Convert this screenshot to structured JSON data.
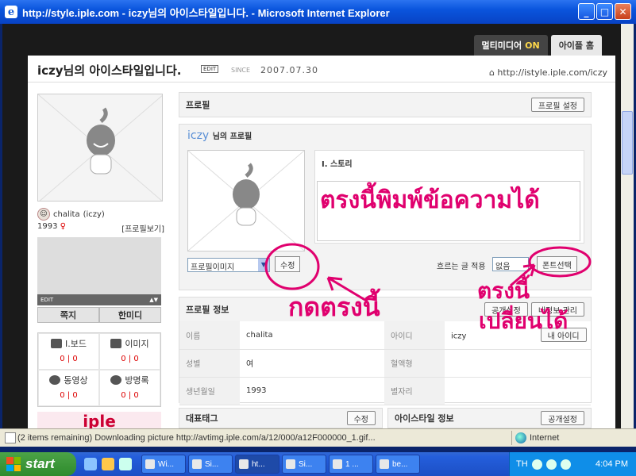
{
  "window": {
    "title": "http://style.iple.com - iczy님의 아이스타일입니다. - Microsoft Internet Explorer",
    "controls": {
      "minimize": "_",
      "maximize": "□",
      "close": "✕"
    }
  },
  "topnav": {
    "multimedia": "멀티미디어",
    "multimedia_state": "ON",
    "home": "아이플 홈"
  },
  "header": {
    "title": "iczy님의 아이스타일입니다.",
    "edit": "EDIT",
    "since": "SINCE",
    "date": "2007.07.30",
    "url": "http://istyle.iple.com/iczy"
  },
  "left": {
    "nick": "chalita",
    "userid": "(iczy)",
    "year": "1993",
    "gender": "♀",
    "profile_view": "[프로필보기]",
    "edit_bar": "EDIT",
    "btn_note": "쪽지",
    "btn_onemedi": "한미디",
    "menu": [
      {
        "label": "I.보드",
        "count": "0 | 0"
      },
      {
        "label": "이미지",
        "count": "0 | 0"
      },
      {
        "label": "동영상",
        "count": "0 | 0"
      },
      {
        "label": "방명록",
        "count": "0 | 0"
      }
    ],
    "logo": "iple"
  },
  "profile_panel": {
    "title": "프로필",
    "settings_btn": "프로필 설정"
  },
  "profile_box": {
    "name": "iczy",
    "suffix": "님의 프로필",
    "story_title": "I. 스토리",
    "image_select": "프로필이미지",
    "edit_btn": "수정",
    "flow_label": "흐르는 글 적용",
    "flow_select": "없음",
    "font_btn": "폰트선택"
  },
  "info_panel": {
    "title": "프로필 정보",
    "public_btn": "공개설정",
    "manage_btn": "내정보 관리",
    "rows": [
      {
        "k1": "이름",
        "v1": "chalita",
        "k2": "아이디",
        "v2": "iczy",
        "btn": "내 아이디"
      },
      {
        "k1": "성별",
        "v1": "여",
        "k2": "혈액형",
        "v2": ""
      },
      {
        "k1": "생년월일",
        "v1": "1993",
        "k2": "별자리",
        "v2": ""
      }
    ]
  },
  "bottom": {
    "tags_title": "대표태그",
    "tags_btn": "수정",
    "istyle_title": "아이스타일 정보",
    "istyle_btn": "공개설정"
  },
  "annotations": {
    "type_text": "ตรงนี้พิมพ์ข้อความได้",
    "click_here": "กดตรงนี้",
    "change_here": "ตรงนี้",
    "change_here2": "เปลี่ยนได้"
  },
  "status": {
    "message": "(2 items remaining) Downloading picture http://avtimg.iple.com/a/12/000/a12F000000_1.gif...",
    "zone": "Internet"
  },
  "taskbar": {
    "start": "start",
    "tasks": [
      "Wi...",
      "Si...",
      "ht...",
      "Si...",
      "1 ...",
      "be..."
    ],
    "lang": "TH",
    "clock": "4:04 PM"
  },
  "colors": {
    "accent": "#5a8fd6",
    "annotation": "#e0006e",
    "title_bar": "#0a55dd"
  }
}
